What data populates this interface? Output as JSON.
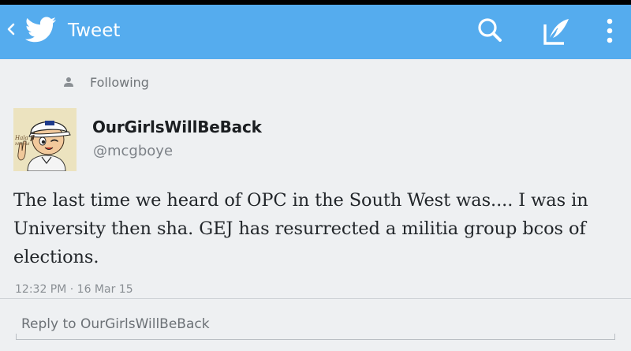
{
  "status_bar": {},
  "action_bar": {
    "title": "Tweet",
    "back_icon": "chevron-left-icon",
    "logo_icon": "twitter-bird-icon",
    "search_icon": "search-icon",
    "compose_icon": "compose-quill-icon",
    "overflow_icon": "more-vertical-icon",
    "background_color": "#55acee"
  },
  "context": {
    "icon": "person-icon",
    "label": "Following"
  },
  "tweet": {
    "avatar_text_top": "Hala",
    "avatar_text_bottom": "Madrid",
    "display_name": "OurGirlsWillBeBack",
    "handle": "@mcgboye",
    "text": "The last time we heard of OPC in the South West was.... I was in University then sha. GEJ has resurrected a militia group bcos of elections.",
    "timestamp": "12:32 PM · 16 Mar 15"
  },
  "reply": {
    "placeholder": "Reply to OurGirlsWillBeBack"
  }
}
